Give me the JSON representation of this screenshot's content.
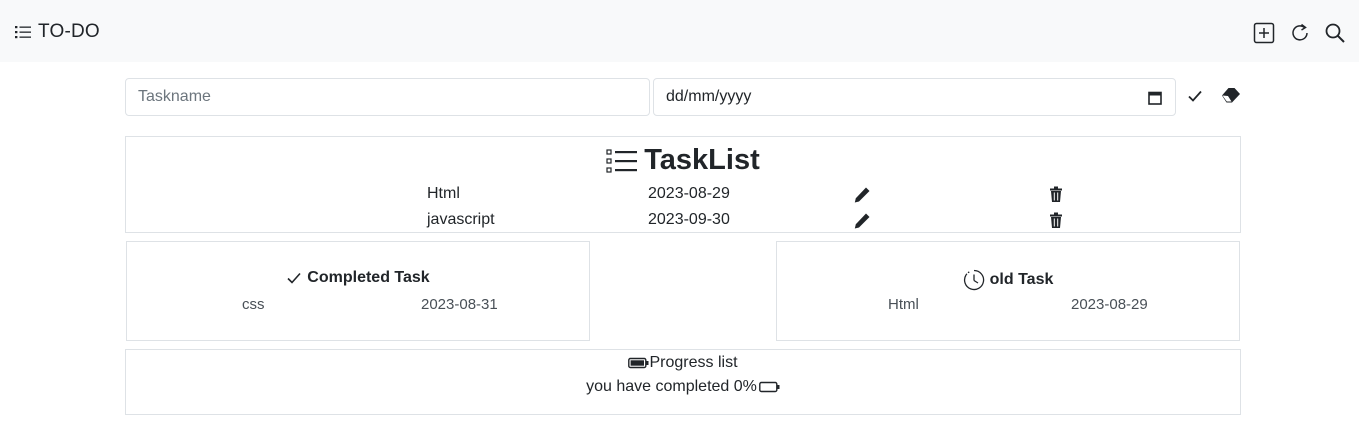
{
  "navbar": {
    "brand": "TO-DO",
    "brand_icon": "list-icon",
    "actions": [
      {
        "icon": "plus-square-icon"
      },
      {
        "icon": "refresh-icon"
      },
      {
        "icon": "search-icon"
      }
    ]
  },
  "form": {
    "task_placeholder": "Taskname",
    "task_value": "",
    "date_value": "dd/mm/yyyy",
    "date_icon": "calendar-icon",
    "submit_icon": "check-icon",
    "clear_icon": "eraser-icon"
  },
  "tasklist": {
    "title": "TaskList",
    "title_icon": "list-task-icon",
    "rows": [
      {
        "name": "Html",
        "date": "2023-08-29",
        "edit_icon": "pencil-icon",
        "delete_icon": "trash-icon"
      },
      {
        "name": "javascript",
        "date": "2023-09-30",
        "edit_icon": "pencil-icon",
        "delete_icon": "trash-icon"
      }
    ]
  },
  "completed": {
    "title": "Completed Task",
    "icon": "check-icon",
    "rows": [
      {
        "name": "css",
        "date": "2023-08-31"
      }
    ]
  },
  "old": {
    "title": "old Task",
    "icon": "clock-history-icon",
    "rows": [
      {
        "name": "Html",
        "date": "2023-08-29"
      }
    ]
  },
  "progress": {
    "title": "Progress list",
    "title_icon": "battery-full-icon",
    "status_text": "you have completed 0%",
    "status_icon": "battery-empty-icon",
    "percent": 0
  },
  "colors": {
    "navbar_bg": "#f8f9fa",
    "border": "#dee2e6",
    "text": "#212529"
  }
}
